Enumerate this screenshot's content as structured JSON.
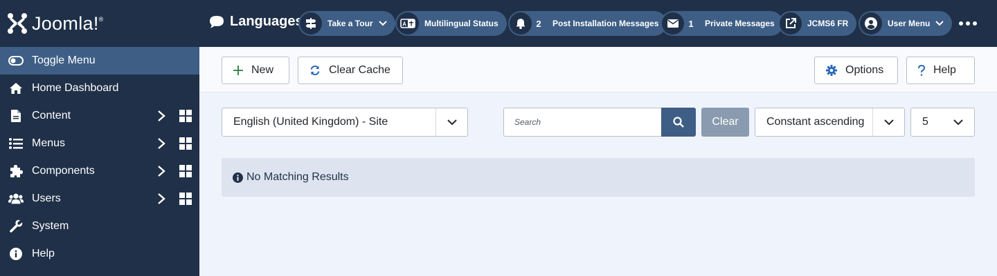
{
  "brand": {
    "name": "Joomla!"
  },
  "sidebar": {
    "items": [
      {
        "label": "Toggle Menu",
        "icon": "toggle-icon"
      },
      {
        "label": "Home Dashboard",
        "icon": "home-icon"
      },
      {
        "label": "Content",
        "icon": "file-icon"
      },
      {
        "label": "Menus",
        "icon": "list-icon"
      },
      {
        "label": "Components",
        "icon": "puzzle-icon"
      },
      {
        "label": "Users",
        "icon": "users-icon"
      },
      {
        "label": "System",
        "icon": "wrench-icon"
      },
      {
        "label": "Help",
        "icon": "info-icon"
      }
    ]
  },
  "header": {
    "title": "Languages:",
    "pills": [
      {
        "label": "Take a Tour",
        "icon": "signpost-icon"
      },
      {
        "label": "Multilingual Status",
        "icon": "language-icon"
      },
      {
        "label": "Post Installation Messages",
        "icon": "bell-icon",
        "count": "2"
      },
      {
        "label": "Private Messages",
        "icon": "envelope-icon",
        "count": "1"
      },
      {
        "label": "JCMS6 FR",
        "icon": "external-link-icon"
      },
      {
        "label": "User Menu",
        "icon": "user-circle-icon"
      }
    ]
  },
  "toolbar": {
    "new_label": "New",
    "clear_cache_label": "Clear Cache",
    "options_label": "Options",
    "help_label": "Help"
  },
  "filters": {
    "language_selected": "English (United Kingdom) - Site",
    "search_placeholder": "Search",
    "clear_label": "Clear",
    "ordering_selected": "Constant ascending",
    "limit_selected": "5"
  },
  "alert": {
    "message": "No Matching Results"
  },
  "colors": {
    "sidebar_bg": "#1f3048",
    "accent": "#3e5e85",
    "page_bg": "#eff3fb",
    "alert_bg": "#dde4ef",
    "clear_button": "#8a9bb0"
  }
}
